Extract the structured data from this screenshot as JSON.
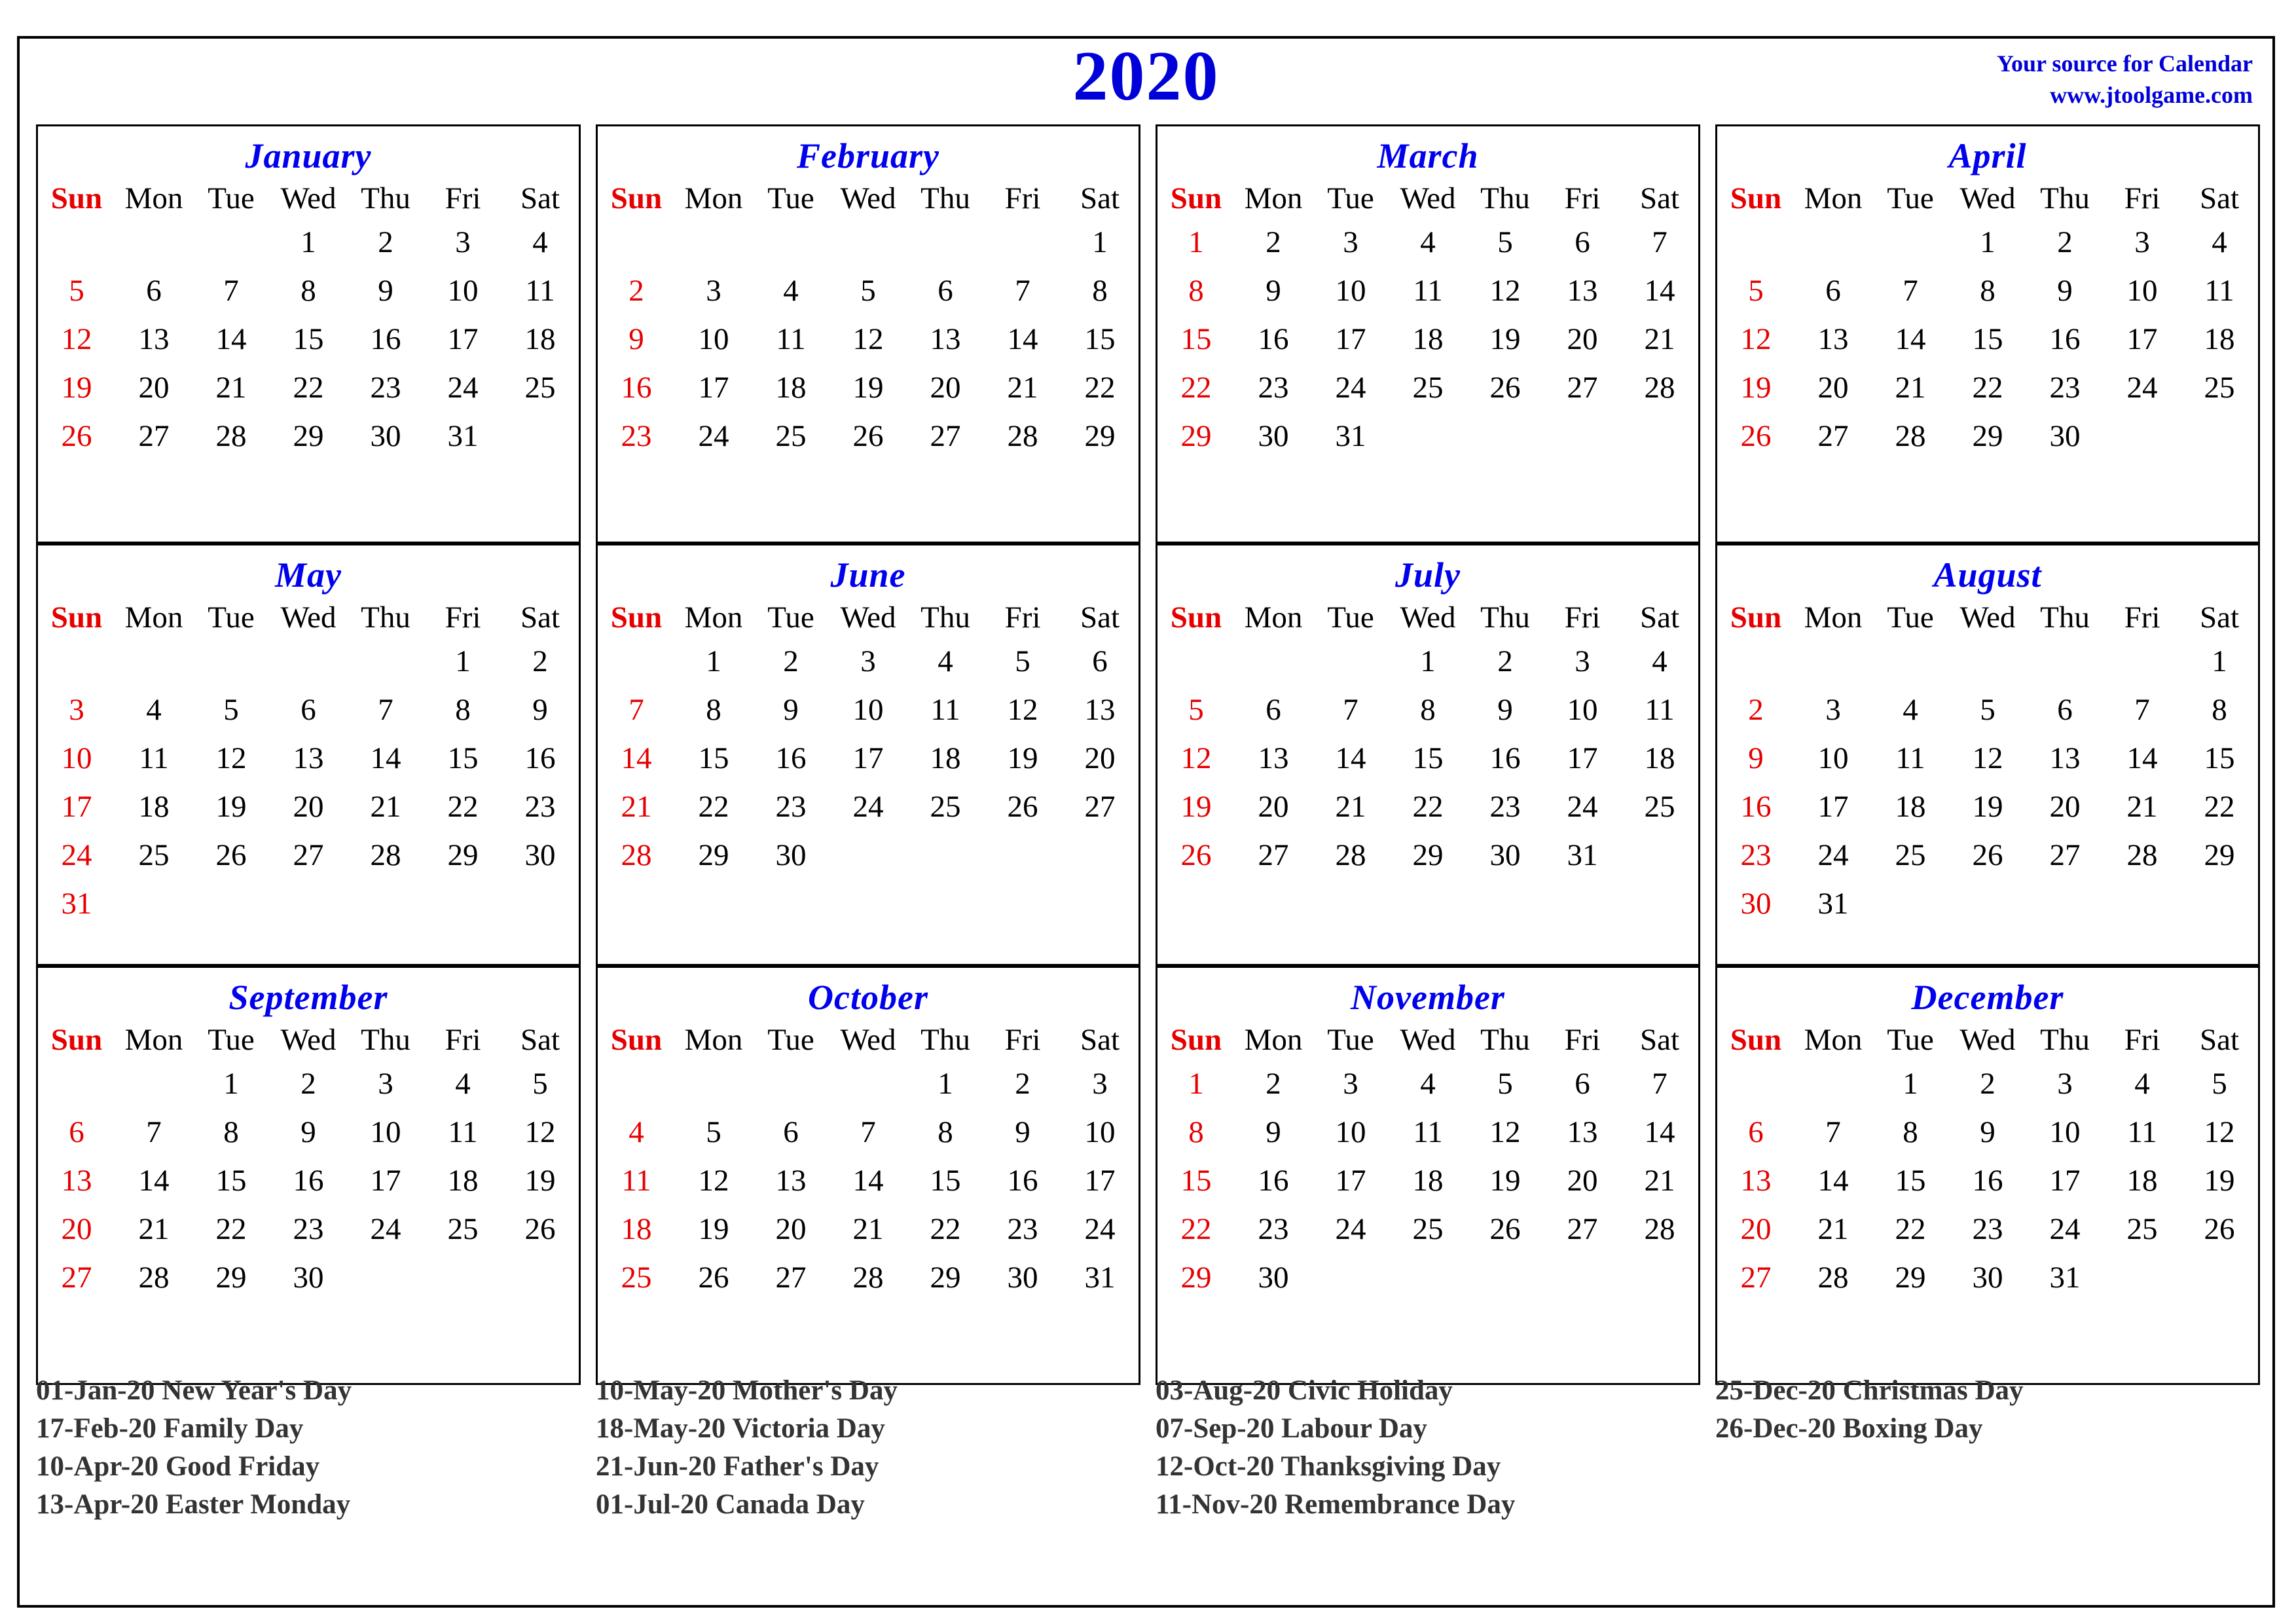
{
  "header": {
    "year": "2020",
    "brand_line1": "Your source for Calendar",
    "brand_line2": "www.jtoolgame.com",
    "title_color": "#0000d8",
    "brand_color": "#0000d8"
  },
  "colors": {
    "month_name": "#0000ee",
    "sunday": "#e60000",
    "weekday": "#000000",
    "holiday_text": "#333333",
    "border": "#000000"
  },
  "weekday_headers": [
    "Sun",
    "Mon",
    "Tue",
    "Wed",
    "Thu",
    "Fri",
    "Sat"
  ],
  "chart_data": {
    "type": "table",
    "title": "2020",
    "description": "Twelve-month 2020 yearly calendar grid, weeks starting Sunday"
  },
  "months": [
    {
      "name": "January",
      "weeks": [
        [
          "",
          "",
          "",
          "1",
          "2",
          "3",
          "4"
        ],
        [
          "5",
          "6",
          "7",
          "8",
          "9",
          "10",
          "11"
        ],
        [
          "12",
          "13",
          "14",
          "15",
          "16",
          "17",
          "18"
        ],
        [
          "19",
          "20",
          "21",
          "22",
          "23",
          "24",
          "25"
        ],
        [
          "26",
          "27",
          "28",
          "29",
          "30",
          "31",
          ""
        ]
      ]
    },
    {
      "name": "February",
      "weeks": [
        [
          "",
          "",
          "",
          "",
          "",
          "",
          "1"
        ],
        [
          "2",
          "3",
          "4",
          "5",
          "6",
          "7",
          "8"
        ],
        [
          "9",
          "10",
          "11",
          "12",
          "13",
          "14",
          "15"
        ],
        [
          "16",
          "17",
          "18",
          "19",
          "20",
          "21",
          "22"
        ],
        [
          "23",
          "24",
          "25",
          "26",
          "27",
          "28",
          "29"
        ]
      ]
    },
    {
      "name": "March",
      "weeks": [
        [
          "1",
          "2",
          "3",
          "4",
          "5",
          "6",
          "7"
        ],
        [
          "8",
          "9",
          "10",
          "11",
          "12",
          "13",
          "14"
        ],
        [
          "15",
          "16",
          "17",
          "18",
          "19",
          "20",
          "21"
        ],
        [
          "22",
          "23",
          "24",
          "25",
          "26",
          "27",
          "28"
        ],
        [
          "29",
          "30",
          "31",
          "",
          "",
          "",
          ""
        ]
      ]
    },
    {
      "name": "April",
      "weeks": [
        [
          "",
          "",
          "",
          "1",
          "2",
          "3",
          "4"
        ],
        [
          "5",
          "6",
          "7",
          "8",
          "9",
          "10",
          "11"
        ],
        [
          "12",
          "13",
          "14",
          "15",
          "16",
          "17",
          "18"
        ],
        [
          "19",
          "20",
          "21",
          "22",
          "23",
          "24",
          "25"
        ],
        [
          "26",
          "27",
          "28",
          "29",
          "30",
          "",
          ""
        ]
      ]
    },
    {
      "name": "May",
      "weeks": [
        [
          "",
          "",
          "",
          "",
          "",
          "1",
          "2"
        ],
        [
          "3",
          "4",
          "5",
          "6",
          "7",
          "8",
          "9"
        ],
        [
          "10",
          "11",
          "12",
          "13",
          "14",
          "15",
          "16"
        ],
        [
          "17",
          "18",
          "19",
          "20",
          "21",
          "22",
          "23"
        ],
        [
          "24",
          "25",
          "26",
          "27",
          "28",
          "29",
          "30"
        ],
        [
          "31",
          "",
          "",
          "",
          "",
          "",
          ""
        ]
      ]
    },
    {
      "name": "June",
      "weeks": [
        [
          "",
          "1",
          "2",
          "3",
          "4",
          "5",
          "6"
        ],
        [
          "7",
          "8",
          "9",
          "10",
          "11",
          "12",
          "13"
        ],
        [
          "14",
          "15",
          "16",
          "17",
          "18",
          "19",
          "20"
        ],
        [
          "21",
          "22",
          "23",
          "24",
          "25",
          "26",
          "27"
        ],
        [
          "28",
          "29",
          "30",
          "",
          "",
          "",
          ""
        ]
      ]
    },
    {
      "name": "July",
      "weeks": [
        [
          "",
          "",
          "",
          "1",
          "2",
          "3",
          "4"
        ],
        [
          "5",
          "6",
          "7",
          "8",
          "9",
          "10",
          "11"
        ],
        [
          "12",
          "13",
          "14",
          "15",
          "16",
          "17",
          "18"
        ],
        [
          "19",
          "20",
          "21",
          "22",
          "23",
          "24",
          "25"
        ],
        [
          "26",
          "27",
          "28",
          "29",
          "30",
          "31",
          ""
        ]
      ]
    },
    {
      "name": "August",
      "weeks": [
        [
          "",
          "",
          "",
          "",
          "",
          "",
          "1"
        ],
        [
          "2",
          "3",
          "4",
          "5",
          "6",
          "7",
          "8"
        ],
        [
          "9",
          "10",
          "11",
          "12",
          "13",
          "14",
          "15"
        ],
        [
          "16",
          "17",
          "18",
          "19",
          "20",
          "21",
          "22"
        ],
        [
          "23",
          "24",
          "25",
          "26",
          "27",
          "28",
          "29"
        ],
        [
          "30",
          "31",
          "",
          "",
          "",
          "",
          ""
        ]
      ]
    },
    {
      "name": "September",
      "weeks": [
        [
          "",
          "",
          "1",
          "2",
          "3",
          "4",
          "5"
        ],
        [
          "6",
          "7",
          "8",
          "9",
          "10",
          "11",
          "12"
        ],
        [
          "13",
          "14",
          "15",
          "16",
          "17",
          "18",
          "19"
        ],
        [
          "20",
          "21",
          "22",
          "23",
          "24",
          "25",
          "26"
        ],
        [
          "27",
          "28",
          "29",
          "30",
          "",
          "",
          ""
        ]
      ]
    },
    {
      "name": "October",
      "weeks": [
        [
          "",
          "",
          "",
          "",
          "1",
          "2",
          "3"
        ],
        [
          "4",
          "5",
          "6",
          "7",
          "8",
          "9",
          "10"
        ],
        [
          "11",
          "12",
          "13",
          "14",
          "15",
          "16",
          "17"
        ],
        [
          "18",
          "19",
          "20",
          "21",
          "22",
          "23",
          "24"
        ],
        [
          "25",
          "26",
          "27",
          "28",
          "29",
          "30",
          "31"
        ]
      ]
    },
    {
      "name": "November",
      "weeks": [
        [
          "1",
          "2",
          "3",
          "4",
          "5",
          "6",
          "7"
        ],
        [
          "8",
          "9",
          "10",
          "11",
          "12",
          "13",
          "14"
        ],
        [
          "15",
          "16",
          "17",
          "18",
          "19",
          "20",
          "21"
        ],
        [
          "22",
          "23",
          "24",
          "25",
          "26",
          "27",
          "28"
        ],
        [
          "29",
          "30",
          "",
          "",
          "",
          "",
          ""
        ]
      ]
    },
    {
      "name": "December",
      "weeks": [
        [
          "",
          "",
          "1",
          "2",
          "3",
          "4",
          "5"
        ],
        [
          "6",
          "7",
          "8",
          "9",
          "10",
          "11",
          "12"
        ],
        [
          "13",
          "14",
          "15",
          "16",
          "17",
          "18",
          "19"
        ],
        [
          "20",
          "21",
          "22",
          "23",
          "24",
          "25",
          "26"
        ],
        [
          "27",
          "28",
          "29",
          "30",
          "31",
          "",
          ""
        ]
      ]
    }
  ],
  "holiday_columns": [
    [
      "01-Jan-20 New Year's Day",
      "17-Feb-20 Family Day",
      "10-Apr-20 Good Friday",
      "13-Apr-20 Easter Monday"
    ],
    [
      "10-May-20 Mother's Day",
      "18-May-20 Victoria Day",
      "21-Jun-20 Father's Day",
      "01-Jul-20 Canada Day"
    ],
    [
      "03-Aug-20 Civic Holiday",
      "07-Sep-20 Labour Day",
      "12-Oct-20 Thanksgiving Day",
      "11-Nov-20 Remembrance Day"
    ],
    [
      "25-Dec-20 Christmas Day",
      "26-Dec-20 Boxing Day"
    ]
  ]
}
